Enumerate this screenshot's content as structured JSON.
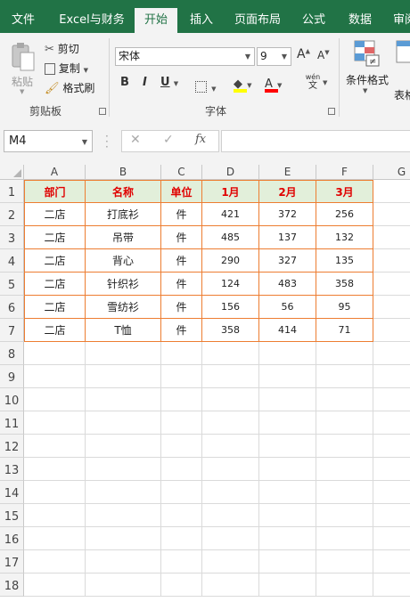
{
  "ribbon_tabs": [
    "文件",
    "Excel与财务",
    "开始",
    "插入",
    "页面布局",
    "公式",
    "数据",
    "审阅"
  ],
  "clipboard": {
    "paste": "粘贴",
    "cut": "剪切",
    "copy": "复制",
    "format_painter": "格式刷",
    "label": "剪贴板"
  },
  "font": {
    "name": "宋体",
    "size": "9",
    "label": "字体",
    "grow": "A",
    "shrink": "A",
    "bold": "B",
    "italic": "I",
    "underline": "U",
    "font_color_letter": "A",
    "phonetic_top": "wén",
    "phonetic_bottom": "文"
  },
  "styles": {
    "conditional_format": "条件格式",
    "table_format": "表格"
  },
  "colors": {
    "fill": "#ffff00",
    "font_color": "#ff0000",
    "header_fill": "#e2efda",
    "header_text": "#e00000",
    "table_border": "#ed7d31",
    "ribbon_green": "#217346"
  },
  "formula_bar": {
    "name_box": "M4",
    "cancel": "✕",
    "enter": "✓",
    "fx": "fx",
    "formula": ""
  },
  "columns": [
    "A",
    "B",
    "C",
    "D",
    "E",
    "F",
    "G"
  ],
  "rows": [
    "1",
    "2",
    "3",
    "4",
    "5",
    "6",
    "7",
    "8",
    "9",
    "10",
    "11",
    "12",
    "13",
    "14",
    "15",
    "16",
    "17",
    "18"
  ],
  "table": {
    "headers": [
      "部门",
      "名称",
      "单位",
      "1月",
      "2月",
      "3月"
    ],
    "rows": [
      [
        "二店",
        "打底衫",
        "件",
        "421",
        "372",
        "256"
      ],
      [
        "二店",
        "吊带",
        "件",
        "485",
        "137",
        "132"
      ],
      [
        "二店",
        "背心",
        "件",
        "290",
        "327",
        "135"
      ],
      [
        "二店",
        "针织衫",
        "件",
        "124",
        "483",
        "358"
      ],
      [
        "二店",
        "雪纺衫",
        "件",
        "156",
        "56",
        "95"
      ],
      [
        "二店",
        "T恤",
        "件",
        "358",
        "414",
        "71"
      ]
    ]
  }
}
